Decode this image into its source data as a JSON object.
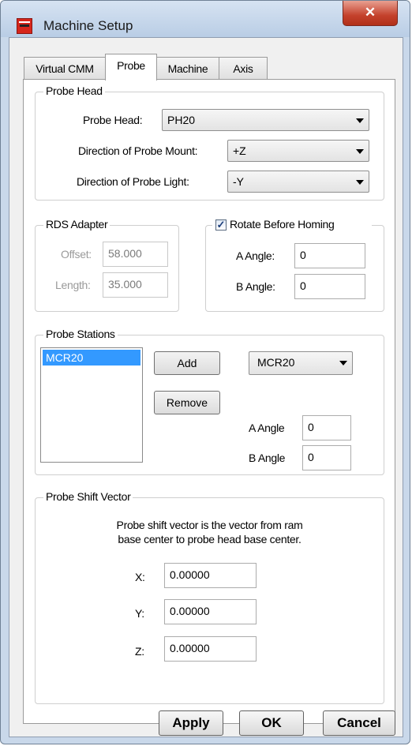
{
  "window": {
    "title": "Machine Setup",
    "close_glyph": "✕"
  },
  "tabs": [
    {
      "label": "Virtual CMM"
    },
    {
      "label": "Probe",
      "active": true
    },
    {
      "label": "Machine"
    },
    {
      "label": "Axis"
    }
  ],
  "probe_head": {
    "legend": "Probe Head",
    "head_label": "Probe Head:",
    "head_value": "PH20",
    "mount_label": "Direction of Probe Mount:",
    "mount_value": "+Z",
    "light_label": "Direction of Probe Light:",
    "light_value": "-Y"
  },
  "rds_adapter": {
    "legend": "RDS Adapter",
    "offset_label": "Offset:",
    "offset_value": "58.000",
    "length_label": "Length:",
    "length_value": "35.000"
  },
  "rotate": {
    "checkbox_label": "Rotate Before Homing",
    "checked": true,
    "check_glyph": "✓",
    "a_label": "A Angle:",
    "a_value": "0",
    "b_label": "B Angle:",
    "b_value": "0"
  },
  "probe_stations": {
    "legend": "Probe Stations",
    "list_items": [
      "MCR20"
    ],
    "add_label": "Add",
    "remove_label": "Remove",
    "type_value": "MCR20",
    "a_label": "A Angle",
    "a_value": "0",
    "b_label": "B Angle",
    "b_value": "0"
  },
  "shift_vector": {
    "legend": "Probe Shift Vector",
    "desc_line1": "Probe shift vector is the vector from ram",
    "desc_line2": "base center to probe head base center.",
    "x_label": "X:",
    "x_value": "0.00000",
    "y_label": "Y:",
    "y_value": "0.00000",
    "z_label": "Z:",
    "z_value": "0.00000"
  },
  "buttons": {
    "apply": "Apply",
    "ok": "OK",
    "cancel": "Cancel"
  }
}
